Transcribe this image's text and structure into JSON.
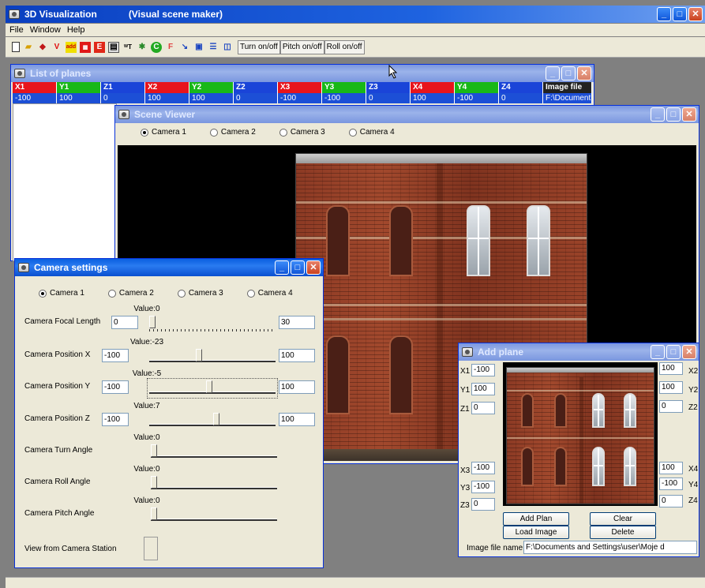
{
  "main_window": {
    "title": "3D Visualization",
    "subtitle": "(Visual scene maker)",
    "menu": [
      "File",
      "Window",
      "Help"
    ],
    "toolbar": {
      "icons": [
        "new-file-icon",
        "open-folder-icon",
        "eraser-icon",
        "v-icon",
        "add-icon",
        "add-plane-icon",
        "e-icon",
        "grid-icon",
        "wt-icon",
        "axes-icon",
        "c-icon",
        "f-icon",
        "pointer-icon",
        "cascade-icon",
        "tile-horizontal-icon",
        "tile-vertical-icon"
      ],
      "buttons": [
        "Turn on/off",
        "Pitch on/off",
        "Roll on/off"
      ]
    }
  },
  "list_of_planes": {
    "title": "List of planes",
    "columns": [
      "X1",
      "Y1",
      "Z1",
      "X2",
      "Y2",
      "Z2",
      "X3",
      "Y3",
      "Z3",
      "X4",
      "Y4",
      "Z4",
      "Image file"
    ],
    "rows": [
      [
        "-100",
        "100",
        "0",
        "100",
        "100",
        "0",
        "-100",
        "-100",
        "0",
        "100",
        "-100",
        "0",
        "F:\\Document"
      ]
    ]
  },
  "scene_viewer": {
    "title": "Scene Viewer",
    "cameras": [
      "Camera 1",
      "Camera 2",
      "Camera 3",
      "Camera 4"
    ],
    "selected_camera": "Camera 1"
  },
  "camera_settings": {
    "title": "Camera settings",
    "cameras": [
      "Camera 1",
      "Camera 2",
      "Camera 3",
      "Camera 4"
    ],
    "selected_camera": "Camera 1",
    "rows": [
      {
        "label": "Camera Focal Length",
        "value_text": "Value:0",
        "min": "0",
        "max": "30",
        "slider": 0
      },
      {
        "label": "Camera Position X",
        "value_text": "Value:-23",
        "min": "-100",
        "max": "100",
        "slider": -23
      },
      {
        "label": "Camera Position Y",
        "value_text": "Value:-5",
        "min": "-100",
        "max": "100",
        "slider": -5
      },
      {
        "label": "Camera Position Z",
        "value_text": "Value:7",
        "min": "-100",
        "max": "100",
        "slider": 7
      },
      {
        "label": "Camera Turn Angle",
        "value_text": "Value:0"
      },
      {
        "label": "Camera Roll Angle",
        "value_text": "Value:0"
      },
      {
        "label": "Camera Pitch Angle",
        "value_text": "Value:0"
      }
    ],
    "station_label": "View from Camera Station"
  },
  "add_plane": {
    "title": "Add plane",
    "left": [
      {
        "label": "X1",
        "value": "-100"
      },
      {
        "label": "Y1",
        "value": "100"
      },
      {
        "label": "Z1",
        "value": "0"
      },
      {
        "label": "X3",
        "value": "-100"
      },
      {
        "label": "Y3",
        "value": "-100"
      },
      {
        "label": "Z3",
        "value": "0"
      }
    ],
    "right": [
      {
        "label": "X2",
        "value": "100"
      },
      {
        "label": "Y2",
        "value": "100"
      },
      {
        "label": "Z2",
        "value": "0"
      },
      {
        "label": "X4",
        "value": "100"
      },
      {
        "label": "Y4",
        "value": "-100"
      },
      {
        "label": "Z4",
        "value": "0"
      }
    ],
    "buttons": {
      "add": "Add Plan",
      "clear": "Clear",
      "load": "Load Image",
      "delete": "Delete"
    },
    "filename_label": "Image file name:",
    "filename_value": "F:\\Documents and Settings\\user\\Moje d"
  }
}
